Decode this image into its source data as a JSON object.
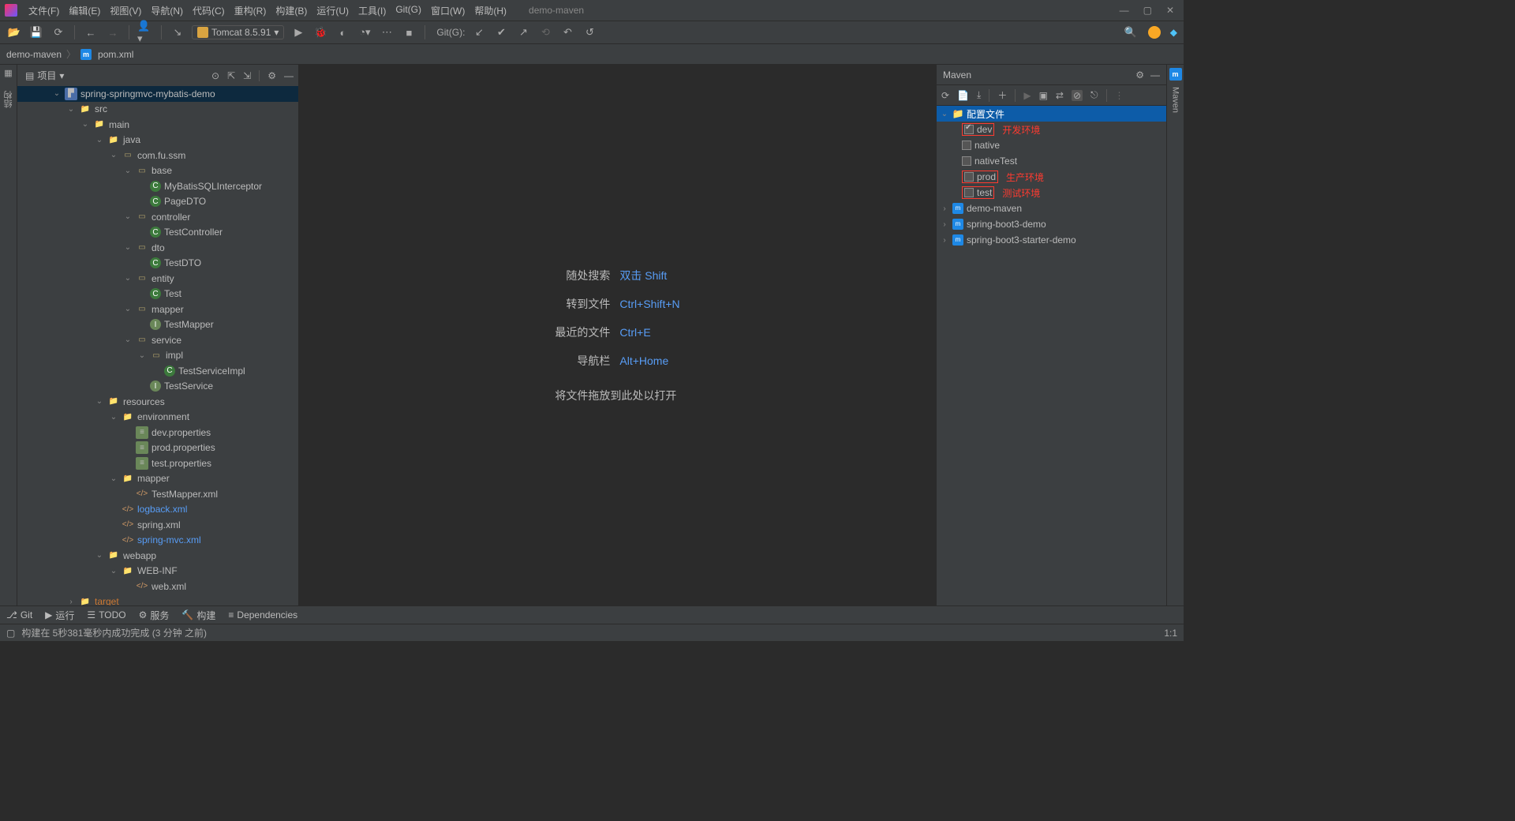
{
  "menubar": {
    "items": [
      "文件(F)",
      "编辑(E)",
      "视图(V)",
      "导航(N)",
      "代码(C)",
      "重构(R)",
      "构建(B)",
      "运行(U)",
      "工具(I)",
      "Git(G)",
      "窗口(W)",
      "帮助(H)"
    ],
    "title": "demo-maven"
  },
  "toolbar": {
    "run_config": "Tomcat 8.5.91",
    "git_label": "Git(G):"
  },
  "breadcrumb": {
    "project": "demo-maven",
    "file": "pom.xml"
  },
  "project_panel": {
    "title": "项目",
    "tree": [
      {
        "depth": 0,
        "arrow": "v",
        "icon": "module",
        "label": "spring-springmvc-mybatis-demo",
        "sel": true
      },
      {
        "depth": 1,
        "arrow": "v",
        "icon": "folder",
        "label": "src"
      },
      {
        "depth": 2,
        "arrow": "v",
        "icon": "folder",
        "label": "main"
      },
      {
        "depth": 3,
        "arrow": "v",
        "icon": "folder",
        "label": "java"
      },
      {
        "depth": 4,
        "arrow": "v",
        "icon": "pkg",
        "label": "com.fu.ssm"
      },
      {
        "depth": 5,
        "arrow": "v",
        "icon": "pkg",
        "label": "base"
      },
      {
        "depth": 6,
        "arrow": "",
        "icon": "class",
        "label": "MyBatisSQLInterceptor"
      },
      {
        "depth": 6,
        "arrow": "",
        "icon": "class",
        "label": "PageDTO"
      },
      {
        "depth": 5,
        "arrow": "v",
        "icon": "pkg",
        "label": "controller"
      },
      {
        "depth": 6,
        "arrow": "",
        "icon": "class",
        "label": "TestController"
      },
      {
        "depth": 5,
        "arrow": "v",
        "icon": "pkg",
        "label": "dto"
      },
      {
        "depth": 6,
        "arrow": "",
        "icon": "class",
        "label": "TestDTO"
      },
      {
        "depth": 5,
        "arrow": "v",
        "icon": "pkg",
        "label": "entity"
      },
      {
        "depth": 6,
        "arrow": "",
        "icon": "class",
        "label": "Test"
      },
      {
        "depth": 5,
        "arrow": "v",
        "icon": "pkg",
        "label": "mapper"
      },
      {
        "depth": 6,
        "arrow": "",
        "icon": "iface",
        "label": "TestMapper"
      },
      {
        "depth": 5,
        "arrow": "v",
        "icon": "pkg",
        "label": "service"
      },
      {
        "depth": 6,
        "arrow": "v",
        "icon": "pkg",
        "label": "impl"
      },
      {
        "depth": 7,
        "arrow": "",
        "icon": "class",
        "label": "TestServiceImpl"
      },
      {
        "depth": 6,
        "arrow": "",
        "icon": "iface",
        "label": "TestService"
      },
      {
        "depth": 3,
        "arrow": "v",
        "icon": "folder",
        "label": "resources"
      },
      {
        "depth": 4,
        "arrow": "v",
        "icon": "folder",
        "label": "environment"
      },
      {
        "depth": 5,
        "arrow": "",
        "icon": "props",
        "label": "dev.properties"
      },
      {
        "depth": 5,
        "arrow": "",
        "icon": "props",
        "label": "prod.properties"
      },
      {
        "depth": 5,
        "arrow": "",
        "icon": "props",
        "label": "test.properties"
      },
      {
        "depth": 4,
        "arrow": "v",
        "icon": "folder",
        "label": "mapper"
      },
      {
        "depth": 5,
        "arrow": "",
        "icon": "xml",
        "label": "TestMapper.xml"
      },
      {
        "depth": 4,
        "arrow": "",
        "icon": "xml",
        "label": "logback.xml",
        "blue": true
      },
      {
        "depth": 4,
        "arrow": "",
        "icon": "xml",
        "label": "spring.xml"
      },
      {
        "depth": 4,
        "arrow": "",
        "icon": "xml",
        "label": "spring-mvc.xml",
        "blue": true
      },
      {
        "depth": 3,
        "arrow": "v",
        "icon": "folder",
        "label": "webapp"
      },
      {
        "depth": 4,
        "arrow": "v",
        "icon": "folder",
        "label": "WEB-INF"
      },
      {
        "depth": 5,
        "arrow": "",
        "icon": "xml",
        "label": "web.xml"
      },
      {
        "depth": 1,
        "arrow": ">",
        "icon": "folder",
        "label": "target",
        "target": true
      }
    ]
  },
  "editor_hints": {
    "rows": [
      {
        "label": "随处搜索",
        "key": "双击 Shift"
      },
      {
        "label": "转到文件",
        "key": "Ctrl+Shift+N"
      },
      {
        "label": "最近的文件",
        "key": "Ctrl+E"
      },
      {
        "label": "导航栏",
        "key": "Alt+Home"
      }
    ],
    "drag": "将文件拖放到此处以打开"
  },
  "maven": {
    "title": "Maven",
    "profiles_label": "配置文件",
    "profiles": [
      {
        "name": "dev",
        "checked": true,
        "red": true,
        "note": "开发环境"
      },
      {
        "name": "native",
        "checked": false
      },
      {
        "name": "nativeTest",
        "checked": false
      },
      {
        "name": "prod",
        "checked": false,
        "red": true,
        "note": "生产环境"
      },
      {
        "name": "test",
        "checked": false,
        "red": true,
        "note": "测试环境"
      }
    ],
    "modules": [
      "demo-maven",
      "spring-boot3-demo",
      "spring-boot3-starter-demo"
    ]
  },
  "right_gutter": {
    "label": "Maven"
  },
  "bottom_tabs": [
    "Git",
    "运行",
    "TODO",
    "服务",
    "构建",
    "Dependencies"
  ],
  "statusbar": {
    "msg": "构建在 5秒381毫秒内成功完成 (3 分钟 之前)",
    "pos": "1:1"
  }
}
